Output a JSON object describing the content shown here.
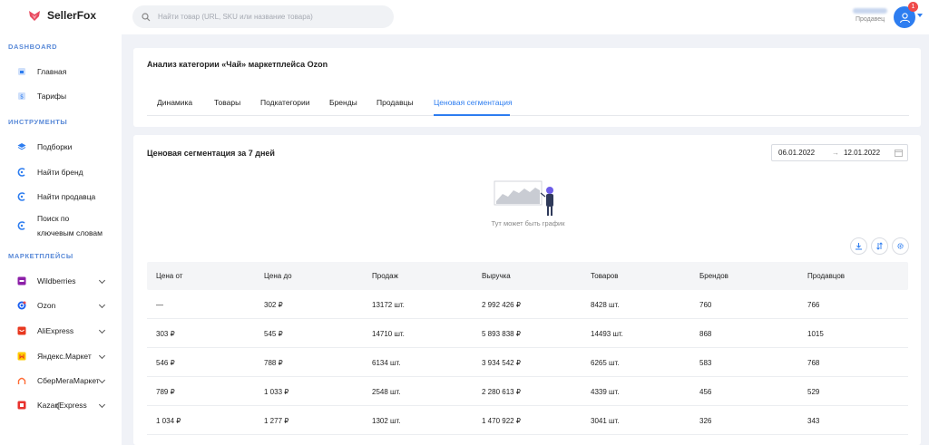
{
  "app": {
    "name": "SellerFox"
  },
  "search": {
    "placeholder": "Найти товар (URL, SKU или название товара)"
  },
  "user": {
    "role": "Продавец",
    "notifications": "1"
  },
  "sidebar": {
    "sections": [
      {
        "title": "DASHBOARD",
        "items": [
          {
            "label": "Главная",
            "icon": "home-icon"
          },
          {
            "label": "Тарифы",
            "icon": "tariff-icon"
          }
        ]
      },
      {
        "title": "ИНСТРУМЕНТЫ",
        "items": [
          {
            "label": "Подборки",
            "icon": "layers-icon"
          },
          {
            "label": "Найти бренд",
            "icon": "search-brand-icon"
          },
          {
            "label": "Найти продавца",
            "icon": "search-seller-icon"
          },
          {
            "label": "Поиск по ключевым словам",
            "line1": "Поиск по",
            "line2": "ключевым словам",
            "icon": "keywords-icon"
          }
        ]
      },
      {
        "title": "МАРКЕТПЛЕЙСЫ",
        "items": [
          {
            "label": "Wildberries",
            "color": "#8c1fa8"
          },
          {
            "label": "Ozon",
            "color": "#1a5ff0"
          },
          {
            "label": "AliExpress",
            "color": "#e8381f"
          },
          {
            "label": "Яндекс.Маркет",
            "color": "#ffcc00"
          },
          {
            "label": "СберМегаМаркет",
            "color": "#ff6b35"
          },
          {
            "label": "KazanExpress",
            "color": "#e8322d"
          }
        ]
      }
    ]
  },
  "page": {
    "title": "Анализ категории «Чай» маркетплейса Ozon",
    "tabs": [
      "Динамика",
      "Товары",
      "Подкатегории",
      "Бренды",
      "Продавцы",
      "Ценовая сегментация"
    ],
    "active_tab": "Ценовая сегментация"
  },
  "segmentation": {
    "title": "Ценовая сегментация за 7 дней",
    "date_from": "06.01.2022",
    "date_to": "12.01.2022",
    "empty_chart_text": "Тут может быть график",
    "table": {
      "headers": [
        "Цена от",
        "Цена до",
        "Продаж",
        "Выручка",
        "Товаров",
        "Брендов",
        "Продавцов"
      ],
      "rows": [
        [
          "—",
          "302 ₽",
          "13172 шт.",
          "2 992 426 ₽",
          "8428 шт.",
          "760",
          "766"
        ],
        [
          "303 ₽",
          "545 ₽",
          "14710 шт.",
          "5 893 838 ₽",
          "14493 шт.",
          "868",
          "1015"
        ],
        [
          "546 ₽",
          "788 ₽",
          "6134 шт.",
          "3 934 542 ₽",
          "6265 шт.",
          "583",
          "768"
        ],
        [
          "789 ₽",
          "1 033 ₽",
          "2548 шт.",
          "2 280 613 ₽",
          "4339 шт.",
          "456",
          "529"
        ],
        [
          "1 034 ₽",
          "1 277 ₽",
          "1302 шт.",
          "1 470 922 ₽",
          "3041 шт.",
          "326",
          "343"
        ]
      ]
    }
  }
}
